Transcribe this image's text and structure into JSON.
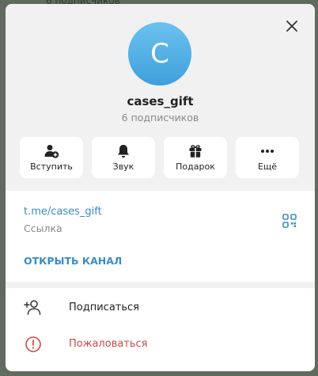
{
  "background": {
    "peek_text": "6 подписчиков"
  },
  "channel": {
    "avatar_letter": "C",
    "name": "cases_gift",
    "subscribers": "6 подписчиков"
  },
  "actions": [
    {
      "label": "Вступить",
      "icon": "add-user-icon"
    },
    {
      "label": "Звук",
      "icon": "bell-icon"
    },
    {
      "label": "Подарок",
      "icon": "gift-icon"
    },
    {
      "label": "Ещё",
      "icon": "more-icon"
    }
  ],
  "link": {
    "url": "t.me/cases_gift",
    "caption": "Ссылка",
    "open_label": "ОТКРЫТЬ КАНАЛ"
  },
  "menu": [
    {
      "label": "Подписаться",
      "icon": "add-user-outline-icon"
    },
    {
      "label": "Пожаловаться",
      "icon": "report-icon"
    }
  ],
  "colors": {
    "accent": "#3a8bc7",
    "avatar_top": "#6cc2ef",
    "avatar_bottom": "#3f9fdc",
    "danger": "#cf4a44",
    "header_bg": "#f1f1f1"
  }
}
